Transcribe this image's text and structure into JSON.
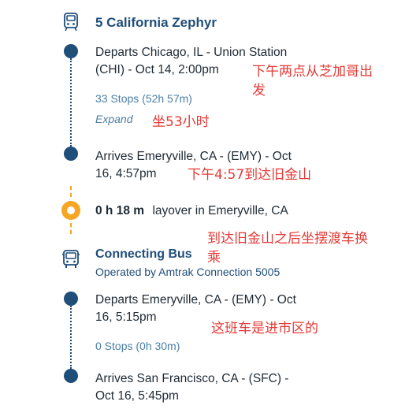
{
  "train": {
    "title": "5 California Zephyr",
    "depart_line1": "Departs Chicago, IL - Union Station",
    "depart_line2": "(CHI) - Oct 14, 2:00pm",
    "stops": "33 Stops (52h 57m)",
    "expand_label": "Expand",
    "arrive_line1": "Arrives Emeryville, CA - (EMY) - Oct",
    "arrive_line2": "16, 4:57pm"
  },
  "layover": {
    "duration": "0 h 18 m",
    "description": "layover in Emeryville, CA"
  },
  "bus": {
    "title": "Connecting Bus",
    "operated_by": "Operated by Amtrak Connection 5005",
    "depart_line1": "Departs Emeryville, CA - (EMY) - Oct",
    "depart_line2": "16, 5:15pm",
    "stops": "0 Stops (0h 30m)",
    "arrive_line1": "Arrives San Francisco, CA - (SFC) -",
    "arrive_line2": "Oct 16, 5:45pm"
  },
  "annotations": {
    "note1_line1": "下午两点从芝加哥出",
    "note1_line2": "发",
    "note2": "坐53小时",
    "note3": "下午4:57到达旧金山",
    "note4_line1": "到达旧金山之后坐摆渡车换",
    "note4_line2": "乘",
    "note5": "这班车是进市区的"
  },
  "colors": {
    "navy": "#1f4e79",
    "link": "#4a7fa6",
    "orange": "#f5a623",
    "annotation_red": "#e53935"
  },
  "icons": {
    "train": "train-icon",
    "layover": "layover-ring-icon",
    "bus": "bus-icon"
  }
}
